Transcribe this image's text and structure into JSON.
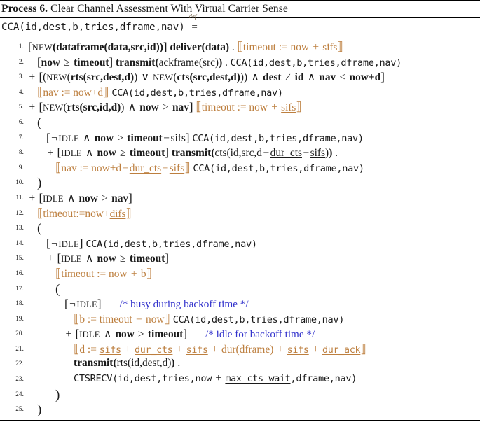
{
  "caption": {
    "label": "Process 6.",
    "text": "Clear Channel Assessment With Virtual Carrier Sense"
  },
  "colors": {
    "assignment": "#bd7f3f",
    "comment": "#3333cc",
    "text": "#1a1a1a",
    "rule": "#000000"
  },
  "definition": {
    "head": "CCA(id,dest,b,tries,dframe,nav)",
    "eq_symbol": "=",
    "eq_superscript": "def"
  },
  "lines": [
    {
      "n": "1.",
      "text": "[NEW(dataframe(data,src,id))] deliver(data) . ⟦timeout := now + sifs⟧"
    },
    {
      "n": "2.",
      "text": "[now ≥ timeout] transmit(ackframe(src)) . CCA(id,dest,b,tries,dframe,nav)"
    },
    {
      "n": "3.",
      "text": "+ [(NEW(rts(src,dest,d)) ∨ NEW(cts(src,dest,d))) ∧ dest ≠ id ∧ nav < now+d]"
    },
    {
      "n": "4.",
      "text": "⟦nav := now+d⟧ CCA(id,dest,b,tries,dframe,nav)"
    },
    {
      "n": "5.",
      "text": "+ [NEW(rts(src,id,d)) ∧ now > nav] ⟦timeout := now + sifs⟧"
    },
    {
      "n": "6.",
      "text": "("
    },
    {
      "n": "7.",
      "text": "[¬IDLE ∧ now > timeout−sifs] CCA(id,dest,b,tries,dframe,nav)"
    },
    {
      "n": "8.",
      "text": "+ [IDLE ∧ now ≥ timeout] transmit(cts(id,src,d−dur_cts−sifs)) ."
    },
    {
      "n": "9.",
      "text": "⟦nav := now+d−dur_cts−sifs⟧ CCA(id,dest,b,tries,dframe,nav)"
    },
    {
      "n": "10.",
      "text": ")"
    },
    {
      "n": "11.",
      "text": "+ [IDLE ∧ now > nav]"
    },
    {
      "n": "12.",
      "text": "⟦timeout:=now+difs⟧"
    },
    {
      "n": "13.",
      "text": "("
    },
    {
      "n": "14.",
      "text": "[¬IDLE] CCA(id,dest,b,tries,dframe,nav)"
    },
    {
      "n": "15.",
      "text": "+ [IDLE ∧ now ≥ timeout]"
    },
    {
      "n": "16.",
      "text": "⟦timeout := now + b⟧"
    },
    {
      "n": "17.",
      "text": "("
    },
    {
      "n": "18.",
      "text": "[¬IDLE]    /* busy during backoff time */"
    },
    {
      "n": "19.",
      "text": "⟦b := timeout − now⟧ CCA(id,dest,b,tries,dframe,nav)"
    },
    {
      "n": "20.",
      "text": "+ [IDLE ∧ now ≥ timeout]    /* idle for backoff time */"
    },
    {
      "n": "21.",
      "text": "⟦d := sifs + dur_cts + sifs + dur(dframe) + sifs + dur_ack⟧"
    },
    {
      "n": "22.",
      "text": "transmit(rts(id,dest,d)) ."
    },
    {
      "n": "23.",
      "text": "CTSRECV(id,dest,tries,now + max_cts_wait,dframe,nav)"
    },
    {
      "n": "24.",
      "text": ")"
    },
    {
      "n": "25.",
      "text": ")"
    }
  ],
  "tokens": {
    "new": "NEW",
    "idle": "IDLE",
    "not": "¬",
    "and": "∧",
    "or": "∨",
    "ge": "≥",
    "gt": ">",
    "lt": "<",
    "ne": "≠",
    "plus": "+",
    "minus": "−",
    "assign": ":=",
    "dot": ".",
    "lbrack": "[",
    "rbrack": "]",
    "lparen": "(",
    "rparen": ")",
    "ldbrack": "⟦",
    "rdbrack": "⟧"
  },
  "constants": [
    "sifs",
    "difs",
    "dur_cts",
    "dur_ack",
    "max_cts_wait"
  ],
  "comments": [
    "/* busy during backoff time */",
    "/* idle for backoff time */"
  ]
}
